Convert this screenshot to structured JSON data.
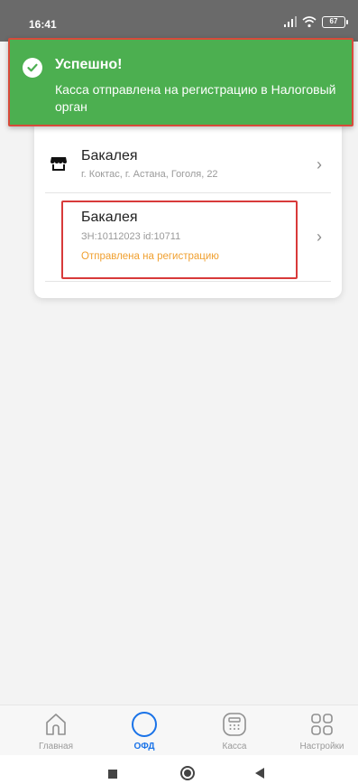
{
  "status_bar": {
    "time": "16:41",
    "battery": "67"
  },
  "toast": {
    "title": "Успешно!",
    "message": "Касса отправлена на регистрацию в Налоговый орган",
    "color": "#4caf50",
    "icon": "check-circle-icon"
  },
  "list": {
    "items": [
      {
        "title": "Бакалея",
        "subtitle": "г. Коктас, г. Астана, Гоголя, 22",
        "icon": "store-icon"
      },
      {
        "title": "Бакалея",
        "subtitle": "ЗН:10112023  id:10711",
        "status": "Отправлена на регистрацию",
        "status_color": "#f0a030"
      }
    ]
  },
  "bottom_nav": {
    "items": [
      {
        "label": "Главная",
        "icon": "home-icon"
      },
      {
        "label": "ОФД",
        "icon": "circle-icon",
        "active": true
      },
      {
        "label": "Касса",
        "icon": "calculator-icon"
      },
      {
        "label": "Настройки",
        "icon": "grid-icon"
      }
    ]
  },
  "system_nav": {
    "icons": [
      "recent-apps-icon",
      "home-button-icon",
      "back-icon"
    ]
  }
}
